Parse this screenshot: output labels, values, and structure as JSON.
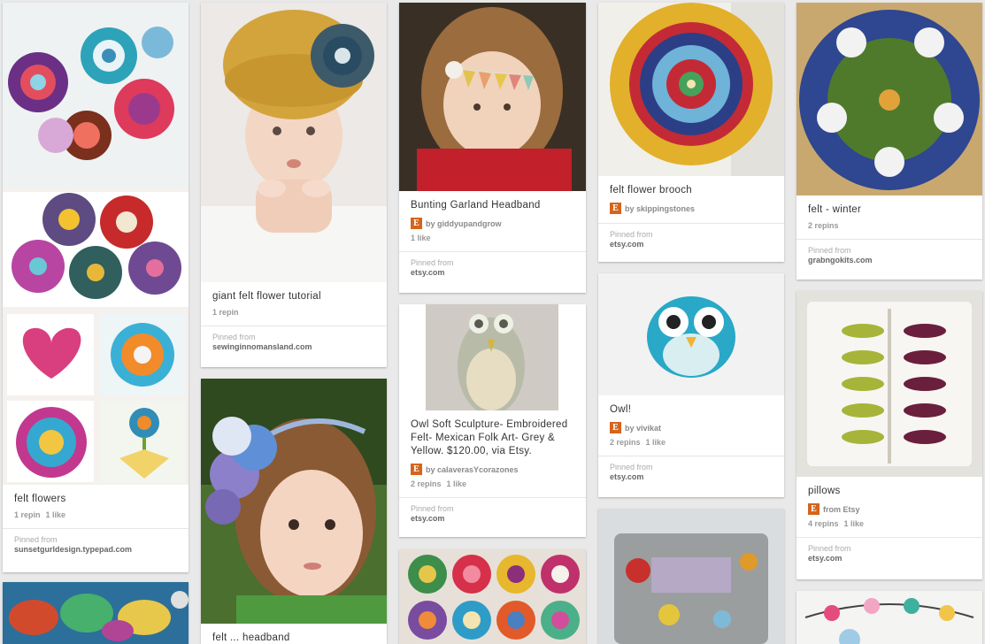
{
  "colors": {
    "background": "#e9e9e9",
    "card": "#ffffff",
    "etsy": "#d5641c"
  },
  "pins": [
    {
      "id": "p1",
      "desc": "felt flowers",
      "by": "",
      "stats": [
        "1 repin",
        "1 like"
      ],
      "pinned_label": "Pinned from",
      "site": "sunsetgurldesign.typepad.com"
    },
    {
      "id": "p2",
      "desc": "giant felt flower tutorial",
      "by": "",
      "stats": [
        "1 repin"
      ],
      "pinned_label": "Pinned from",
      "site": "sewinginnomansland.com"
    },
    {
      "id": "p3",
      "desc": "Bunting Garland Headband",
      "by": "by giddyupandgrow",
      "stats": [
        "1 like"
      ],
      "pinned_label": "Pinned from",
      "site": "etsy.com"
    },
    {
      "id": "p4",
      "desc": "Owl Soft Sculpture- Embroidered Felt- Mexican Folk Art- Grey & Yellow. $120.00, via Etsy.",
      "by": "by calaverasYcorazones",
      "stats": [
        "2 repins",
        "1 like"
      ],
      "pinned_label": "Pinned from",
      "site": "etsy.com"
    },
    {
      "id": "p5",
      "desc": "felt flower brooch",
      "by": "by skippingstones",
      "stats": [],
      "pinned_label": "Pinned from",
      "site": "etsy.com"
    },
    {
      "id": "p6",
      "desc": "Owl!",
      "by": "by vivikat",
      "stats": [
        "2 repins",
        "1 like"
      ],
      "pinned_label": "Pinned from",
      "site": "etsy.com"
    },
    {
      "id": "p7",
      "desc": "felt - winter",
      "by": "",
      "stats": [
        "2 repins"
      ],
      "pinned_label": "Pinned from",
      "site": "grabngokits.com"
    },
    {
      "id": "p8",
      "desc": "pillows",
      "by": "from Etsy",
      "stats": [
        "4 repins",
        "1 like"
      ],
      "pinned_label": "Pinned from",
      "site": "etsy.com"
    },
    {
      "id": "p9",
      "desc": "felt ... headband",
      "by": "",
      "stats": [],
      "pinned_label": "",
      "site": ""
    }
  ]
}
